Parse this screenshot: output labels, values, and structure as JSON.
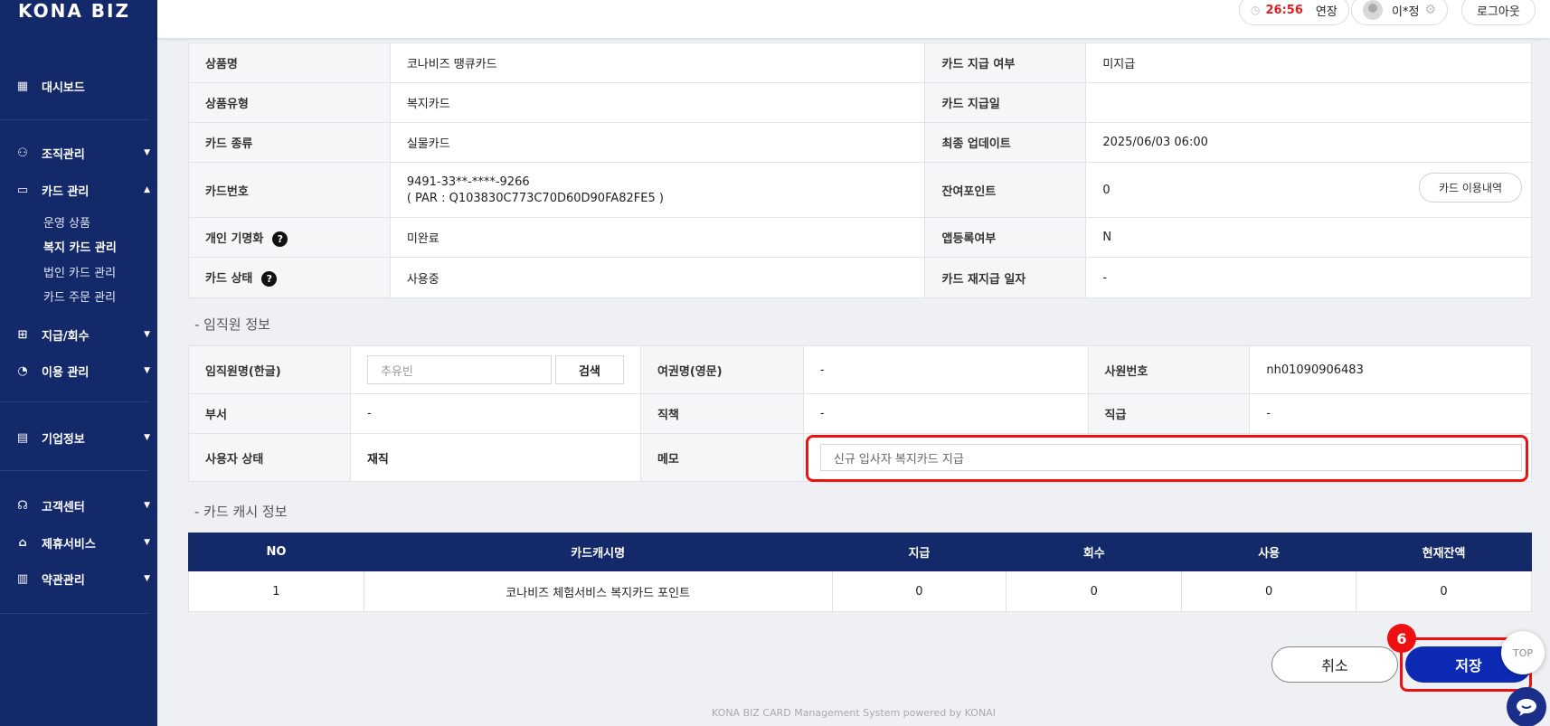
{
  "brand": "KONA BIZ",
  "sidebar": {
    "items": [
      {
        "label": "대시보드",
        "icon": "dashboard-icon"
      },
      {
        "label": "조직관리",
        "icon": "organization-icon"
      },
      {
        "label": "카드 관리",
        "icon": "card-icon"
      },
      {
        "label": "지급/회수",
        "icon": "payment-icon"
      },
      {
        "label": "이용 관리",
        "icon": "usage-icon"
      },
      {
        "label": "기업정보",
        "icon": "company-icon"
      },
      {
        "label": "고객센터",
        "icon": "support-icon"
      },
      {
        "label": "제휴서비스",
        "icon": "partner-icon"
      },
      {
        "label": "약관관리",
        "icon": "terms-icon"
      }
    ],
    "card_sub": [
      "운영 상품",
      "복지 카드 관리",
      "법인 카드 관리",
      "카드 주문 관리"
    ]
  },
  "topbar": {
    "timer": "26:56",
    "extend": "연장",
    "user": "이*정",
    "logout": "로그아웃"
  },
  "card_info": {
    "product_name_label": "상품명",
    "product_name": "코나비즈 땡큐카드",
    "issue_status_label": "카드 지급 여부",
    "issue_status": "미지급",
    "product_type_label": "상품유형",
    "product_type": "복지카드",
    "issue_date_label": "카드 지급일",
    "issue_date": "",
    "card_kind_label": "카드 종류",
    "card_kind": "실물카드",
    "last_update_label": "최종 업데이트",
    "last_update": "2025/06/03 06:00",
    "card_number_label": "카드번호",
    "card_number": "9491-33**-****-9266",
    "par": "( PAR : Q103830C773C70D60D90FA82FE5 )",
    "points_label": "잔여포인트",
    "points": "0",
    "usage_button": "카드 이용내역",
    "personalize_label": "개인 기명화",
    "personalize": "미완료",
    "app_reg_label": "앱등록여부",
    "app_reg": "N",
    "status_label": "카드 상태",
    "status": "사용중",
    "reissue_label": "카드 재지급 일자",
    "reissue": "-"
  },
  "employee": {
    "section_title": "- 임직원 정보",
    "name_label": "임직원명(한글)",
    "name_placeholder": "추유빈",
    "search_button": "검색",
    "passport_label": "여권명(영문)",
    "passport": "-",
    "emp_no_label": "사원번호",
    "emp_no": "nh01090906483",
    "dept_label": "부서",
    "dept": "-",
    "duty_label": "직책",
    "duty": "-",
    "rank_label": "직급",
    "rank": "-",
    "user_status_label": "사용자 상태",
    "user_status": "재직",
    "memo_label": "메모",
    "memo": "신규 입사자 복지카드 지급"
  },
  "cash": {
    "section_title": "- 카드 캐시 정보",
    "headers": [
      "NO",
      "카드캐시명",
      "지급",
      "회수",
      "사용",
      "현재잔액"
    ],
    "rows": [
      [
        "1",
        "코나비즈 체험서비스 복지카드 포인트",
        "0",
        "0",
        "0",
        "0"
      ]
    ]
  },
  "actions": {
    "cancel": "취소",
    "save": "저장",
    "top": "TOP",
    "step_badge": "6"
  },
  "footer": "KONA BIZ CARD Management System powered by KONAI",
  "colors": {
    "sidebar": "#14296a",
    "save_button": "#0c2ab4",
    "highlight": "#ee1111",
    "timer": "#e02020"
  }
}
